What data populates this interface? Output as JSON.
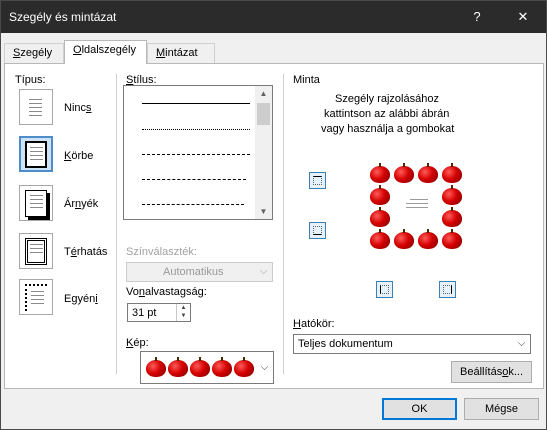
{
  "dialog": {
    "title": "Szegély és mintázat",
    "help_glyph": "?",
    "close_glyph": "✕"
  },
  "tabs": [
    {
      "label_pre": "",
      "label_u": "S",
      "label_post": "zegély"
    },
    {
      "label_pre": "",
      "label_u": "O",
      "label_post": "ldalszegély"
    },
    {
      "label_pre": "",
      "label_u": "M",
      "label_post": "intázat"
    }
  ],
  "setting": {
    "heading": "Típus:",
    "items": [
      {
        "name": "Nincs",
        "pre": "Ninc",
        "u": "s",
        "post": ""
      },
      {
        "name": "Körbe",
        "pre": "",
        "u": "K",
        "post": "örbe"
      },
      {
        "name": "Árnyék",
        "pre": "Ár",
        "u": "n",
        "post": "yék"
      },
      {
        "name": "Térhatás",
        "pre": "T",
        "u": "é",
        "post": "rhatás"
      },
      {
        "name": "Egyéni",
        "pre": "Egyén",
        "u": "i",
        "post": ""
      }
    ],
    "selected": "Körbe"
  },
  "style": {
    "heading_u": "S",
    "heading_rest": "tílus:",
    "scroll_up": "▲",
    "scroll_down": "▼"
  },
  "color": {
    "label": "Színválaszték:",
    "value": "Automatikus",
    "arrow": "⌵"
  },
  "width": {
    "label_pre": "Vo",
    "label_u": "n",
    "label_post": "alvastagság:",
    "value": "31 pt",
    "up": "▲",
    "down": "▼"
  },
  "art": {
    "label_u": "K",
    "label_rest": "ép:",
    "arrow": "⌵"
  },
  "preview": {
    "heading": "Minta",
    "instruction_1": "Szegély rajzolásához",
    "instruction_2": "kattintson az alábbi ábrán",
    "instruction_3": "vagy használja a gombokat"
  },
  "apply_to": {
    "label_u": "H",
    "label_rest": "atókör:",
    "value": "Teljes dokumentum",
    "arrow": "⌵"
  },
  "buttons": {
    "options_pre": "Beállítás",
    "options_u": "o",
    "options_post": "k...",
    "ok": "OK",
    "cancel": "Mégse"
  },
  "colors": {
    "accent": "#0078d7",
    "titlebar": "#2b2b2b",
    "apple": "#d40000"
  }
}
